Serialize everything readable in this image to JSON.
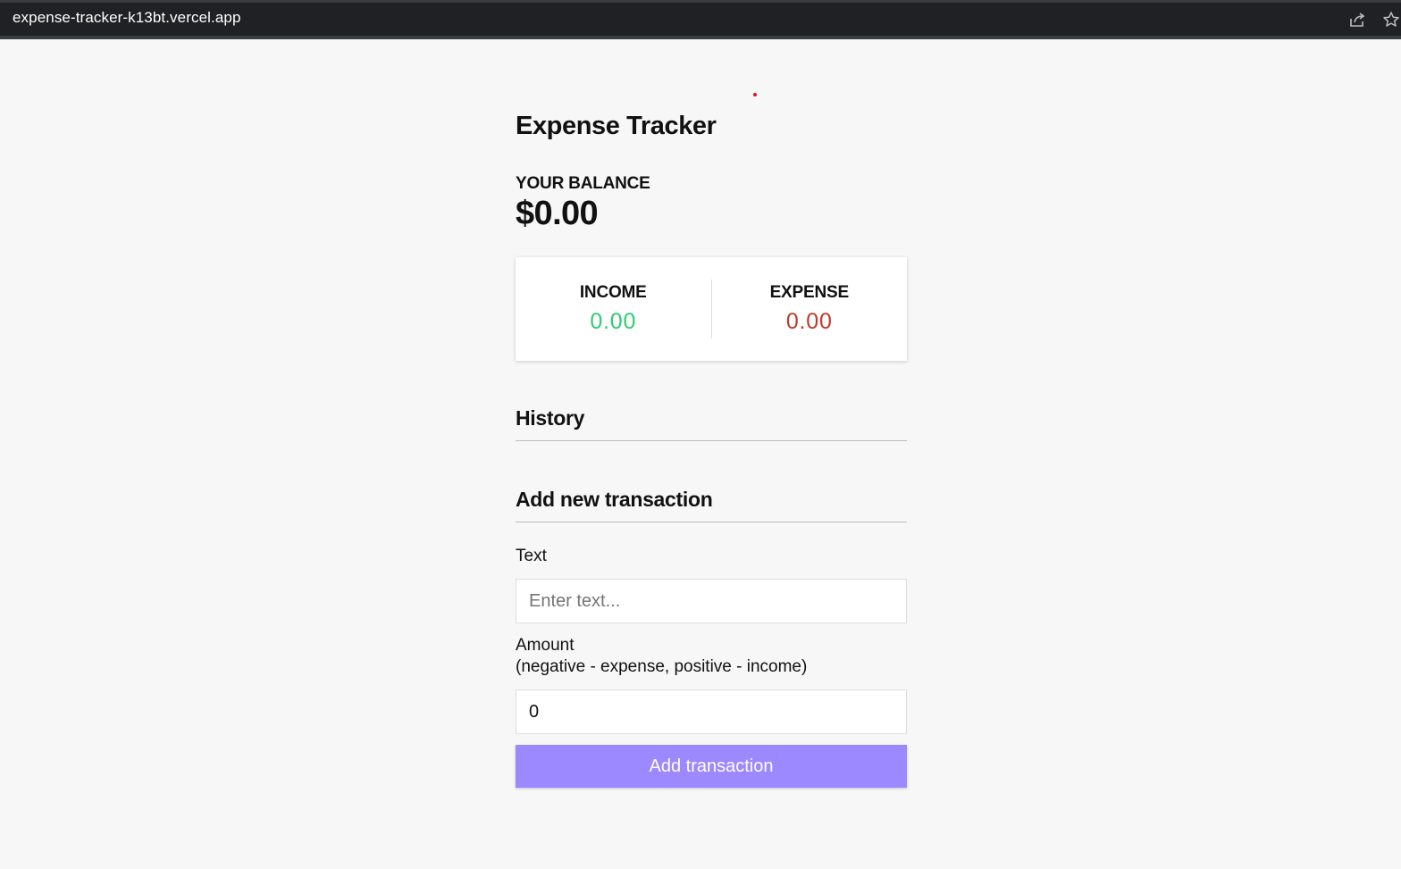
{
  "browser": {
    "url": "expense-tracker-k13bt.vercel.app",
    "icons": [
      "share-icon",
      "star-icon"
    ]
  },
  "app": {
    "title": "Expense Tracker"
  },
  "balance": {
    "label": "YOUR BALANCE",
    "value": "$0.00"
  },
  "summary": {
    "income_label": "INCOME",
    "income_value": "0.00",
    "expense_label": "EXPENSE",
    "expense_value": "0.00"
  },
  "history": {
    "title": "History"
  },
  "form": {
    "title": "Add new transaction",
    "text_label": "Text",
    "text_placeholder": "Enter text...",
    "text_value": "",
    "amount_label": "Amount",
    "amount_hint": "(negative - expense, positive - income)",
    "amount_value": "0",
    "submit_label": "Add transaction"
  },
  "colors": {
    "income": "#2ecc71",
    "expense": "#c0392b",
    "button": "#9c88ff",
    "background": "#f7f7f7"
  }
}
